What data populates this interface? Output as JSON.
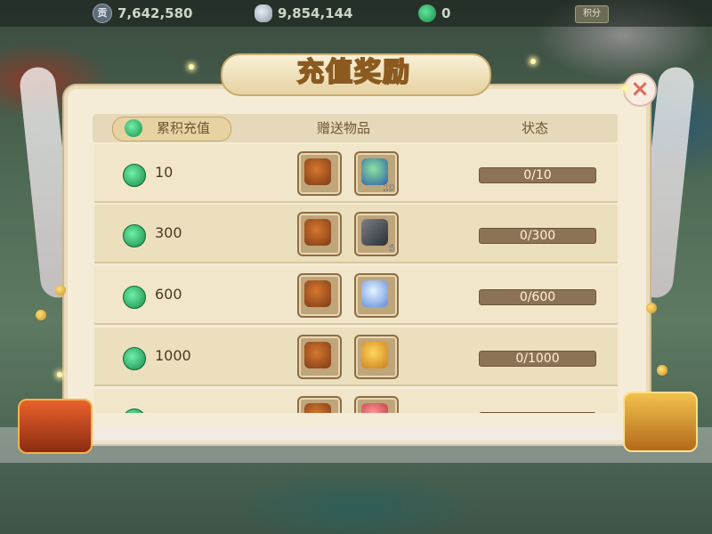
{
  "top_bar": {
    "tribute": {
      "icon": "tribute-coin-icon",
      "glyph": "贡",
      "value": "7,642,580"
    },
    "silver": {
      "icon": "silver-ingot-icon",
      "value": "9,854,144"
    },
    "jade": {
      "icon": "jade-icon",
      "value": "0"
    },
    "score_label": "积分"
  },
  "dialog": {
    "title": "充值奖励",
    "close_glyph": "×",
    "headers": {
      "cumulative": "累积充值",
      "gift_items": "赠送物品",
      "status": "状态"
    },
    "rows": [
      {
        "amount": "10",
        "items": [
          {
            "icon": "treasure-bag-icon",
            "count": ""
          },
          {
            "icon": "herb-vase-icon",
            "count": "10"
          }
        ],
        "status": "0/10"
      },
      {
        "amount": "300",
        "items": [
          {
            "icon": "treasure-bag-icon",
            "count": ""
          },
          {
            "icon": "dark-blade-icon",
            "count": "6"
          }
        ],
        "status": "0/300"
      },
      {
        "amount": "600",
        "items": [
          {
            "icon": "treasure-bag-icon",
            "count": ""
          },
          {
            "icon": "crystal-orb-icon",
            "count": ""
          }
        ],
        "status": "0/600"
      },
      {
        "amount": "1000",
        "items": [
          {
            "icon": "treasure-bag-icon",
            "count": ""
          },
          {
            "icon": "gold-pouch-icon",
            "count": ""
          }
        ],
        "status": "0/1000"
      },
      {
        "amount": "",
        "items": [
          {
            "icon": "treasure-bag-icon",
            "count": ""
          },
          {
            "icon": "red-pouch-icon",
            "count": ""
          }
        ],
        "status": ""
      }
    ]
  },
  "colors": {
    "panel": "#f4ecd6",
    "row_odd": "#f1e6c9",
    "row_even": "#ecdfbd",
    "status_bar": "#8d7355",
    "jade": "#1b8a4a",
    "close": "#e06a5a"
  }
}
